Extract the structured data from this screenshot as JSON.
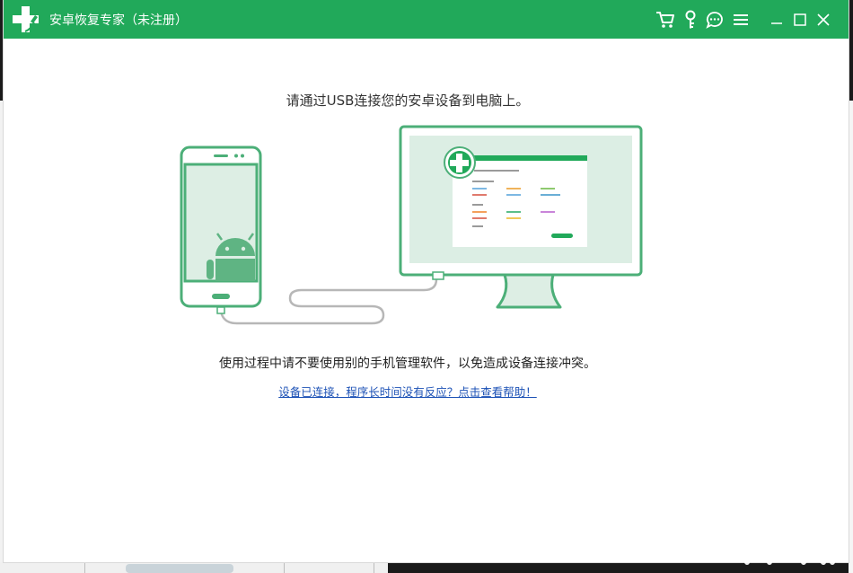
{
  "window": {
    "title": "安卓恢复专家（未注册）",
    "accent_color": "#21a95a"
  },
  "titlebar_icons": [
    "cart-icon",
    "key-icon",
    "feedback-icon",
    "menu-icon",
    "minimize-icon",
    "maximize-icon",
    "close-icon"
  ],
  "main": {
    "instruction": "请通过USB连接您的安卓设备到电脑上。",
    "warning": "使用过程中请不要使用别的手机管理软件，以免造成设备连接冲突。",
    "help_link": "设备已连接，程序长时间没有反应？点击查看帮助！"
  },
  "illustration": {
    "phone_icon": "android-robot-icon",
    "monitor_icon": "app-screenshot-thumbnail",
    "line_color": "#4caf78"
  }
}
